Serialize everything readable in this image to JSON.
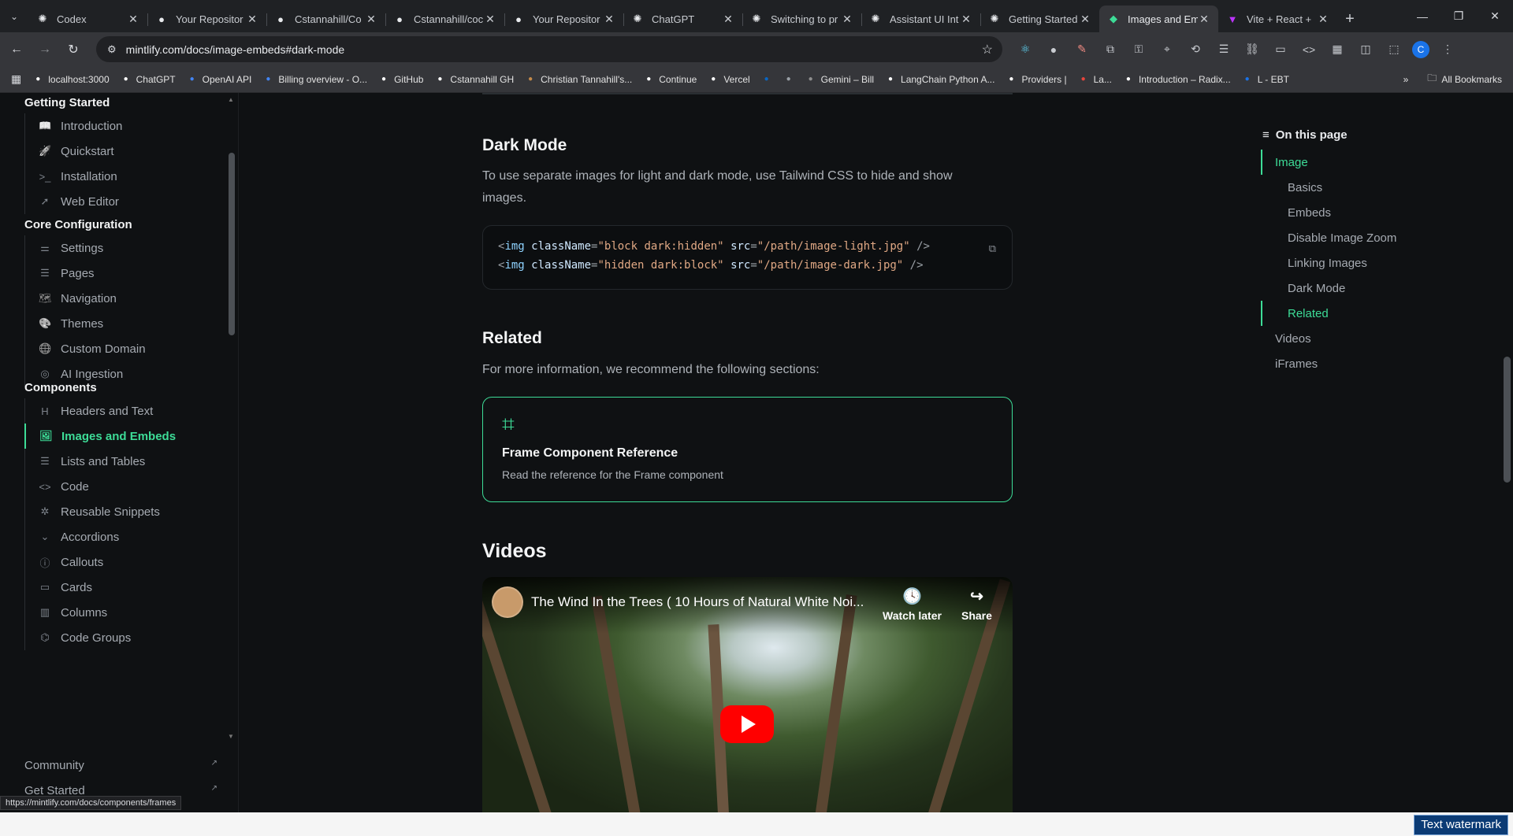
{
  "browser": {
    "tabs": [
      {
        "title": "Codex",
        "icon": "openai-icon"
      },
      {
        "title": "Your Repositor",
        "icon": "github-icon"
      },
      {
        "title": "Cstannahill/Co",
        "icon": "github-icon"
      },
      {
        "title": "Cstannahill/coc",
        "icon": "github-icon"
      },
      {
        "title": "Your Repositor",
        "icon": "github-icon"
      },
      {
        "title": "ChatGPT",
        "icon": "openai-icon"
      },
      {
        "title": "Switching to pr",
        "icon": "openai-icon"
      },
      {
        "title": "Assistant UI Int",
        "icon": "openai-icon"
      },
      {
        "title": "Getting Started",
        "icon": "openai-icon"
      },
      {
        "title": "Images and Em",
        "icon": "mintlify-icon",
        "active": true
      },
      {
        "title": "Vite + React +",
        "icon": "vite-icon"
      }
    ],
    "address": "mintlify.com/docs/image-embeds#dark-mode",
    "bookmarks": [
      "localhost:3000",
      "ChatGPT",
      "OpenAI API",
      "Billing overview - O...",
      "GitHub",
      "Cstannahill GH",
      "Christian Tannahill's...",
      "Continue",
      "Vercel",
      "",
      "",
      "Gemini – Bill",
      "LangChain Python A...",
      "Providers |",
      "La...",
      "Introduction – Radix...",
      "L - EBT"
    ],
    "all_bookmarks": "All Bookmarks",
    "profile_initial": "C",
    "status_url": "https://mintlify.com/docs/components/frames",
    "watermark": "Text watermark"
  },
  "sidebar": {
    "sections": [
      {
        "title": "Getting Started",
        "items": [
          {
            "label": "Introduction",
            "icon": "book-icon"
          },
          {
            "label": "Quickstart",
            "icon": "rocket-icon"
          },
          {
            "label": "Installation",
            "icon": "terminal-icon"
          },
          {
            "label": "Web Editor",
            "icon": "cursor-icon"
          }
        ]
      },
      {
        "title": "Core Configuration",
        "items": [
          {
            "label": "Settings",
            "icon": "sliders-icon"
          },
          {
            "label": "Pages",
            "icon": "pages-icon"
          },
          {
            "label": "Navigation",
            "icon": "map-icon"
          },
          {
            "label": "Themes",
            "icon": "palette-icon"
          },
          {
            "label": "Custom Domain",
            "icon": "globe-icon"
          },
          {
            "label": "AI Ingestion",
            "icon": "ai-icon"
          }
        ]
      },
      {
        "title": "Components",
        "items": [
          {
            "label": "Headers and Text",
            "icon": "heading-icon"
          },
          {
            "label": "Images and Embeds",
            "icon": "image-icon",
            "active": true
          },
          {
            "label": "Lists and Tables",
            "icon": "list-icon"
          },
          {
            "label": "Code",
            "icon": "code-icon"
          },
          {
            "label": "Reusable Snippets",
            "icon": "puzzle-icon"
          },
          {
            "label": "Accordions",
            "icon": "chevron-down-icon"
          },
          {
            "label": "Callouts",
            "icon": "info-icon"
          },
          {
            "label": "Cards",
            "icon": "card-icon"
          },
          {
            "label": "Columns",
            "icon": "columns-icon"
          },
          {
            "label": "Code Groups",
            "icon": "code-group-icon"
          }
        ]
      }
    ],
    "footer_links": [
      "Community",
      "Get Started"
    ]
  },
  "content": {
    "dark_mode_heading": "Dark Mode",
    "dark_mode_text_1": "To use separate images for light and dark mode, use Tailwind CSS to hide and show",
    "dark_mode_text_2": "images.",
    "code_lines": [
      {
        "tag": "img",
        "attr1": "className",
        "val1": "\"block dark:hidden\"",
        "attr2": "src",
        "val2": "\"/path/image-light.jpg\""
      },
      {
        "tag": "img",
        "attr1": "className",
        "val1": "\"hidden dark:block\"",
        "attr2": "src",
        "val2": "\"/path/image-dark.jpg\""
      }
    ],
    "related_heading": "Related",
    "related_text": "For more information, we recommend the following sections:",
    "card_title": "Frame Component Reference",
    "card_desc": "Read the reference for the Frame component",
    "videos_heading": "Videos",
    "video_title": "The Wind In the Trees ( 10 Hours of Natural White Noi...",
    "video_watch_later": "Watch later",
    "video_share": "Share"
  },
  "toc": {
    "heading": "On this page",
    "items": [
      {
        "label": "Image",
        "level": 1,
        "active": true
      },
      {
        "label": "Basics",
        "level": 2
      },
      {
        "label": "Embeds",
        "level": 2
      },
      {
        "label": "Disable Image Zoom",
        "level": 2
      },
      {
        "label": "Linking Images",
        "level": 2
      },
      {
        "label": "Dark Mode",
        "level": 2
      },
      {
        "label": "Related",
        "level": 2,
        "active": true
      },
      {
        "label": "Videos",
        "level": 1
      },
      {
        "label": "iFrames",
        "level": 1
      }
    ]
  },
  "colors": {
    "accent": "#3ddc97",
    "background": "#0f1113"
  }
}
